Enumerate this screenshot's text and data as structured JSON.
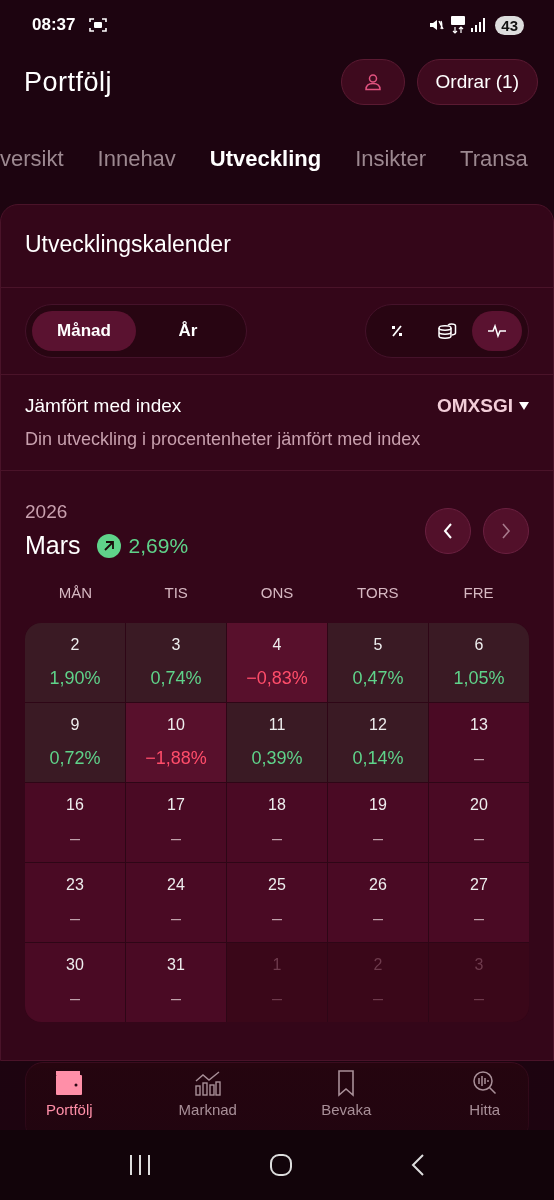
{
  "status_bar": {
    "time": "08:37",
    "battery": "43"
  },
  "header": {
    "title": "Portfölj",
    "orders_button": "Ordrar (1)"
  },
  "tabs": [
    {
      "label": "versikt",
      "selected": false
    },
    {
      "label": "Innehav",
      "selected": false
    },
    {
      "label": "Utveckling",
      "selected": true
    },
    {
      "label": "Insikter",
      "selected": false
    },
    {
      "label": "Transa",
      "selected": false
    }
  ],
  "card": {
    "title": "Utvecklingskalender",
    "period_toggle": [
      {
        "label": "Månad",
        "selected": true
      },
      {
        "label": "År",
        "selected": false
      }
    ],
    "view_toggle": [
      {
        "kind": "percent",
        "selected": false
      },
      {
        "kind": "coins",
        "selected": false
      },
      {
        "kind": "pulse",
        "selected": true
      }
    ],
    "index": {
      "label": "Jämfört med index",
      "value": "OMXSGI",
      "description": "Din utveckling i procentenheter jämfört med index"
    },
    "year": "2026",
    "month": "Mars",
    "month_change": {
      "text": "2,69%",
      "kind": "gain"
    },
    "weekdays": [
      "MÅN",
      "TIS",
      "ONS",
      "TORS",
      "FRE"
    ],
    "days": [
      {
        "day": "2",
        "change": "1,90%",
        "kind": "gain",
        "outside": false
      },
      {
        "day": "3",
        "change": "0,74%",
        "kind": "gain",
        "outside": false
      },
      {
        "day": "4",
        "change": "−0,83%",
        "kind": "loss",
        "outside": false
      },
      {
        "day": "5",
        "change": "0,47%",
        "kind": "gain",
        "outside": false
      },
      {
        "day": "6",
        "change": "1,05%",
        "kind": "gain",
        "outside": false
      },
      {
        "day": "9",
        "change": "0,72%",
        "kind": "gain",
        "outside": false
      },
      {
        "day": "10",
        "change": "−1,88%",
        "kind": "loss",
        "outside": false
      },
      {
        "day": "11",
        "change": "0,39%",
        "kind": "gain",
        "outside": false
      },
      {
        "day": "12",
        "change": "0,14%",
        "kind": "gain",
        "outside": false
      },
      {
        "day": "13",
        "change": "–",
        "kind": "empty",
        "outside": false
      },
      {
        "day": "16",
        "change": "–",
        "kind": "empty",
        "outside": false
      },
      {
        "day": "17",
        "change": "–",
        "kind": "empty",
        "outside": false
      },
      {
        "day": "18",
        "change": "–",
        "kind": "empty",
        "outside": false
      },
      {
        "day": "19",
        "change": "–",
        "kind": "empty",
        "outside": false
      },
      {
        "day": "20",
        "change": "–",
        "kind": "empty",
        "outside": false
      },
      {
        "day": "23",
        "change": "–",
        "kind": "empty",
        "outside": false
      },
      {
        "day": "24",
        "change": "–",
        "kind": "empty",
        "outside": false
      },
      {
        "day": "25",
        "change": "–",
        "kind": "empty",
        "outside": false
      },
      {
        "day": "26",
        "change": "–",
        "kind": "empty",
        "outside": false
      },
      {
        "day": "27",
        "change": "–",
        "kind": "empty",
        "outside": false
      },
      {
        "day": "30",
        "change": "–",
        "kind": "empty",
        "outside": false
      },
      {
        "day": "31",
        "change": "–",
        "kind": "empty",
        "outside": false
      },
      {
        "day": "1",
        "change": "–",
        "kind": "empty",
        "outside": true
      },
      {
        "day": "2",
        "change": "–",
        "kind": "empty",
        "outside": true
      },
      {
        "day": "3",
        "change": "–",
        "kind": "empty",
        "outside": true
      }
    ]
  },
  "bottom_nav": [
    {
      "kind": "wallet",
      "label": "Portfölj",
      "selected": true
    },
    {
      "kind": "chart",
      "label": "Marknad",
      "selected": false
    },
    {
      "kind": "bookmark",
      "label": "Bevaka",
      "selected": false
    },
    {
      "kind": "search",
      "label": "Hitta",
      "selected": false
    }
  ]
}
